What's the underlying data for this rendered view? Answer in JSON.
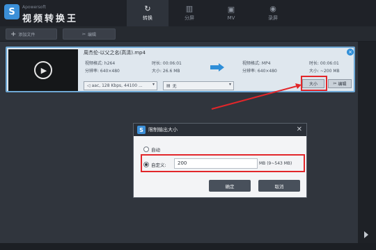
{
  "app": {
    "brand_en": "Apowersoft",
    "brand_cn": "视频转换王",
    "logo_letter": "S"
  },
  "tabs": [
    {
      "label": "转换",
      "icon": "↻"
    },
    {
      "label": "分屏",
      "icon": "▥"
    },
    {
      "label": "MV",
      "icon": "▣"
    },
    {
      "label": "录屏",
      "icon": "◉"
    }
  ],
  "toolbar": {
    "add_file": "添加文件",
    "edit": "编辑"
  },
  "file": {
    "name": "周杰伦-以父之名(高清).mp4",
    "src_format": "视频格式: h264",
    "src_resolution": "分辨率: 640×480",
    "src_duration": "时长: 00:06:01",
    "src_size": "大小: 26.6 MB",
    "out_format": "视频格式: MP4",
    "out_resolution": "分辨率: 640×480",
    "out_duration": "时长: 00:06:01",
    "out_size": "大小: ~200 MB",
    "audio_select": "aac, 128 Kbps, 44100 ...",
    "subtitle_select": "无",
    "size_button": "大小",
    "edit_button": "编辑"
  },
  "dialog": {
    "title": "限制输出大小",
    "option_auto": "自动",
    "option_custom": "自定义:",
    "custom_value": "200",
    "unit_hint": "MB (9~543 MB)",
    "ok": "确定",
    "cancel": "取消"
  },
  "colors": {
    "accent": "#2e8ed8",
    "highlight": "#e2262a"
  }
}
